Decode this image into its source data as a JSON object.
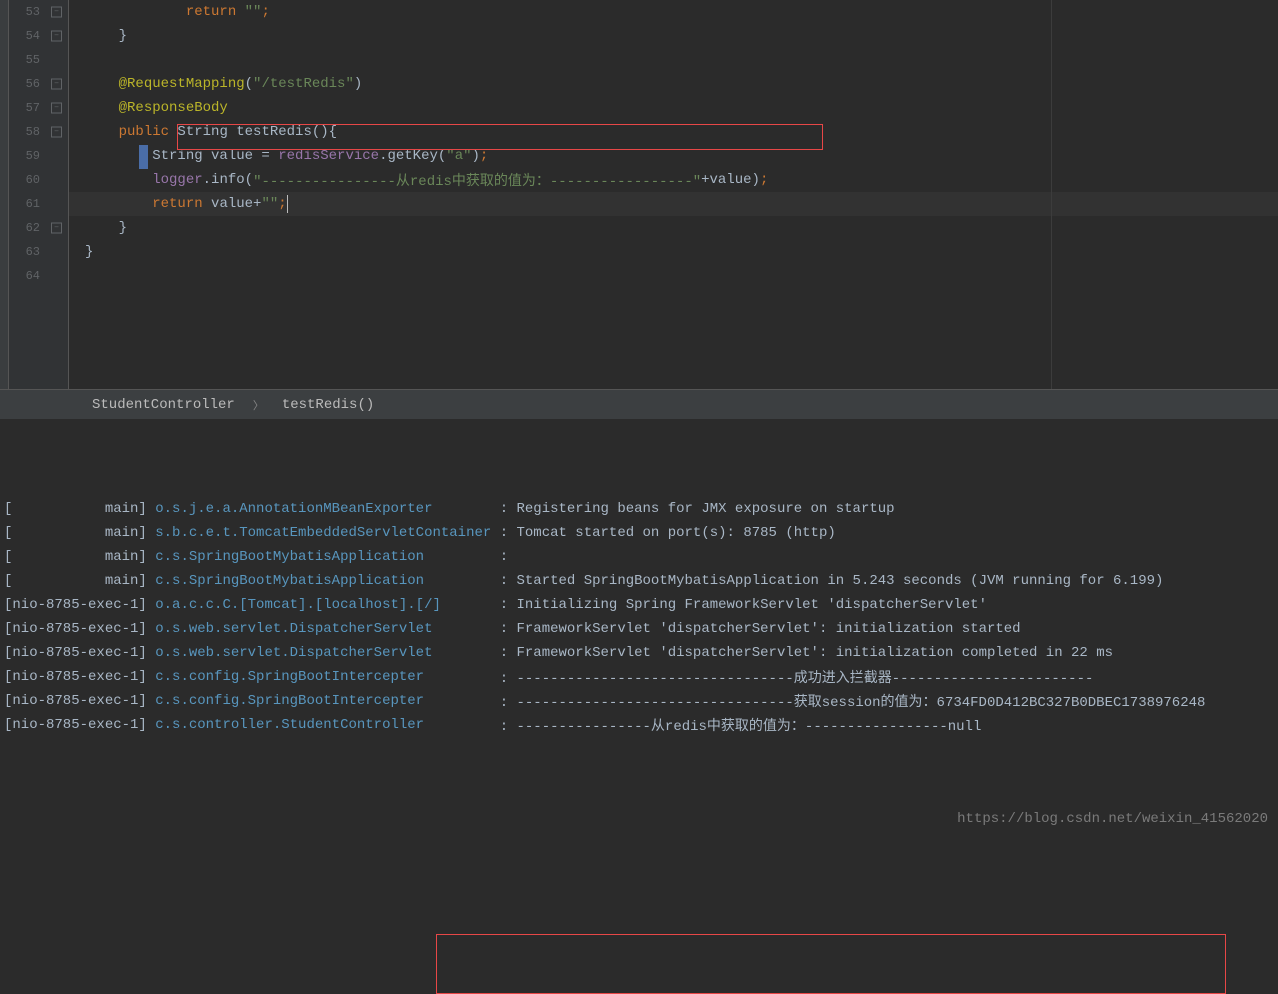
{
  "editor": {
    "lines": [
      {
        "num": "53",
        "fold": "close",
        "tokens": [
          {
            "t": "",
            "c": "plain",
            "indent": 3
          },
          {
            "t": "return",
            "c": "kw"
          },
          {
            "t": " \"\"",
            "c": "str"
          },
          {
            "t": ";",
            "c": "sc"
          }
        ]
      },
      {
        "num": "54",
        "fold": "close",
        "tokens": [
          {
            "t": "",
            "c": "plain",
            "indent": 1
          },
          {
            "t": "}",
            "c": "plain"
          }
        ]
      },
      {
        "num": "55",
        "tokens": []
      },
      {
        "num": "56",
        "fold": "open",
        "yellow": true,
        "tokens": [
          {
            "t": "",
            "c": "plain",
            "indent": 1
          },
          {
            "t": "@RequestMapping",
            "c": "ann"
          },
          {
            "t": "(",
            "c": "plain"
          },
          {
            "t": "\"/testRedis\"",
            "c": "str"
          },
          {
            "t": ")",
            "c": "plain"
          }
        ]
      },
      {
        "num": "57",
        "fold": "close",
        "yellow": true,
        "tokens": [
          {
            "t": "",
            "c": "plain",
            "indent": 1
          },
          {
            "t": "@ResponseBody",
            "c": "ann"
          }
        ]
      },
      {
        "num": "58",
        "fold": "open",
        "yellow": true,
        "tokens": [
          {
            "t": "",
            "c": "plain",
            "indent": 1
          },
          {
            "t": "public",
            "c": "kw"
          },
          {
            "t": " String ",
            "c": "type"
          },
          {
            "t": "testRedis",
            "c": "type"
          },
          {
            "t": "(){",
            "c": "plain"
          }
        ]
      },
      {
        "num": "59",
        "blue": true,
        "tokens": [
          {
            "t": "",
            "c": "plain",
            "indent": 2
          },
          {
            "t": "String value = ",
            "c": "plain"
          },
          {
            "t": "redisService",
            "c": "field"
          },
          {
            "t": ".getKey(",
            "c": "plain"
          },
          {
            "t": "\"a\"",
            "c": "str"
          },
          {
            "t": ")",
            "c": "plain"
          },
          {
            "t": ";",
            "c": "sc"
          }
        ]
      },
      {
        "num": "60",
        "tokens": [
          {
            "t": "",
            "c": "plain",
            "indent": 2
          },
          {
            "t": "logger",
            "c": "field"
          },
          {
            "t": ".info(",
            "c": "plain"
          },
          {
            "t": "\"----------------从redis中获取的值为：-----------------\"",
            "c": "str"
          },
          {
            "t": "+value)",
            "c": "plain"
          },
          {
            "t": ";",
            "c": "sc"
          }
        ]
      },
      {
        "num": "61",
        "cursor": true,
        "tokens": [
          {
            "t": "",
            "c": "plain",
            "indent": 2
          },
          {
            "t": "return",
            "c": "kw"
          },
          {
            "t": " value+",
            "c": "plain"
          },
          {
            "t": "\"\"",
            "c": "str"
          },
          {
            "t": ";",
            "c": "sc"
          }
        ]
      },
      {
        "num": "62",
        "fold": "close",
        "tokens": [
          {
            "t": "",
            "c": "plain",
            "indent": 1
          },
          {
            "t": "}",
            "c": "plain"
          }
        ]
      },
      {
        "num": "63",
        "tokens": [
          {
            "t": "}",
            "c": "plain"
          }
        ]
      },
      {
        "num": "64",
        "tokens": []
      }
    ]
  },
  "breadcrumb": {
    "class": "StudentController",
    "method": "testRedis()"
  },
  "console": {
    "lines": [
      {
        "thread": "[           main]",
        "logger": "o.s.j.e.a.AnnotationMBeanExporter       ",
        "msg": " : Registering beans for JMX exposure on startup"
      },
      {
        "thread": "[           main]",
        "logger": "s.b.c.e.t.TomcatEmbeddedServletContainer",
        "msg": " : Tomcat started on port(s): 8785 (http)"
      },
      {
        "thread": "[           main]",
        "logger": "c.s.SpringBootMybatisApplication        ",
        "msg": " : "
      },
      {
        "thread": "[           main]",
        "logger": "c.s.SpringBootMybatisApplication        ",
        "msg": " : Started SpringBootMybatisApplication in 5.243 seconds (JVM running for 6.199)"
      },
      {
        "thread": "[nio-8785-exec-1]",
        "logger": "o.a.c.c.C.[Tomcat].[localhost].[/]      ",
        "msg": " : Initializing Spring FrameworkServlet 'dispatcherServlet'"
      },
      {
        "thread": "[nio-8785-exec-1]",
        "logger": "o.s.web.servlet.DispatcherServlet       ",
        "msg": " : FrameworkServlet 'dispatcherServlet': initialization started"
      },
      {
        "thread": "[nio-8785-exec-1]",
        "logger": "o.s.web.servlet.DispatcherServlet       ",
        "msg": " : FrameworkServlet 'dispatcherServlet': initialization completed in 22 ms"
      },
      {
        "thread": "[nio-8785-exec-1]",
        "logger": "c.s.config.SpringBootIntercepter        ",
        "msg": " : ---------------------------------成功进入拦截器------------------------"
      },
      {
        "thread": "[nio-8785-exec-1]",
        "logger": "c.s.config.SpringBootIntercepter        ",
        "msg": " : ---------------------------------获取session的值为：6734FD0D412BC327B0DBEC1738976248"
      },
      {
        "thread": "[nio-8785-exec-1]",
        "logger": "c.s.controller.StudentController        ",
        "msg": " : ----------------从redis中获取的值为：-----------------null"
      }
    ]
  },
  "watermark": "https://blog.csdn.net/weixin_41562020"
}
